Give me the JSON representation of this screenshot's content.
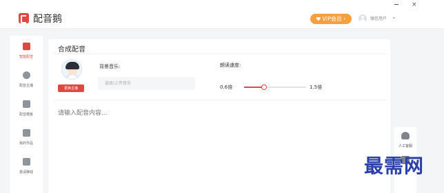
{
  "app": {
    "title": "配音鹅"
  },
  "header": {
    "vip_label": "VIP会员",
    "vip_arrow": "›",
    "user_name": "微信用户",
    "user_chevron": "⌄",
    "window_min": "—",
    "window_close": "×"
  },
  "sidebar": {
    "items": [
      {
        "label": "智能配音",
        "icon": "dubbing-icon",
        "active": true
      },
      {
        "label": "配音主播",
        "icon": "anchor-icon",
        "active": false
      },
      {
        "label": "配音模板",
        "icon": "template-icon",
        "active": false
      },
      {
        "label": "我的作品",
        "icon": "folder-icon",
        "active": false
      },
      {
        "label": "邀请赚钱",
        "icon": "gift-icon",
        "active": false
      }
    ]
  },
  "main": {
    "title": "合成配音",
    "change_anchor_label": "更换主播",
    "bgm_label": "背景音乐:",
    "bgm_placeholder": "选择/上传音乐",
    "speed_label": "朗读速度:",
    "speed_min": "0.6倍",
    "speed_max": "1.5倍",
    "speed_value": 0.32,
    "content_placeholder": "请输入配音内容..."
  },
  "float_panel": {
    "customer_service_label": "人工客服"
  },
  "watermark": "最需网",
  "colors": {
    "accent": "#e3463f",
    "vip": "#f6a03d",
    "watermark": "#2b3fa8"
  }
}
